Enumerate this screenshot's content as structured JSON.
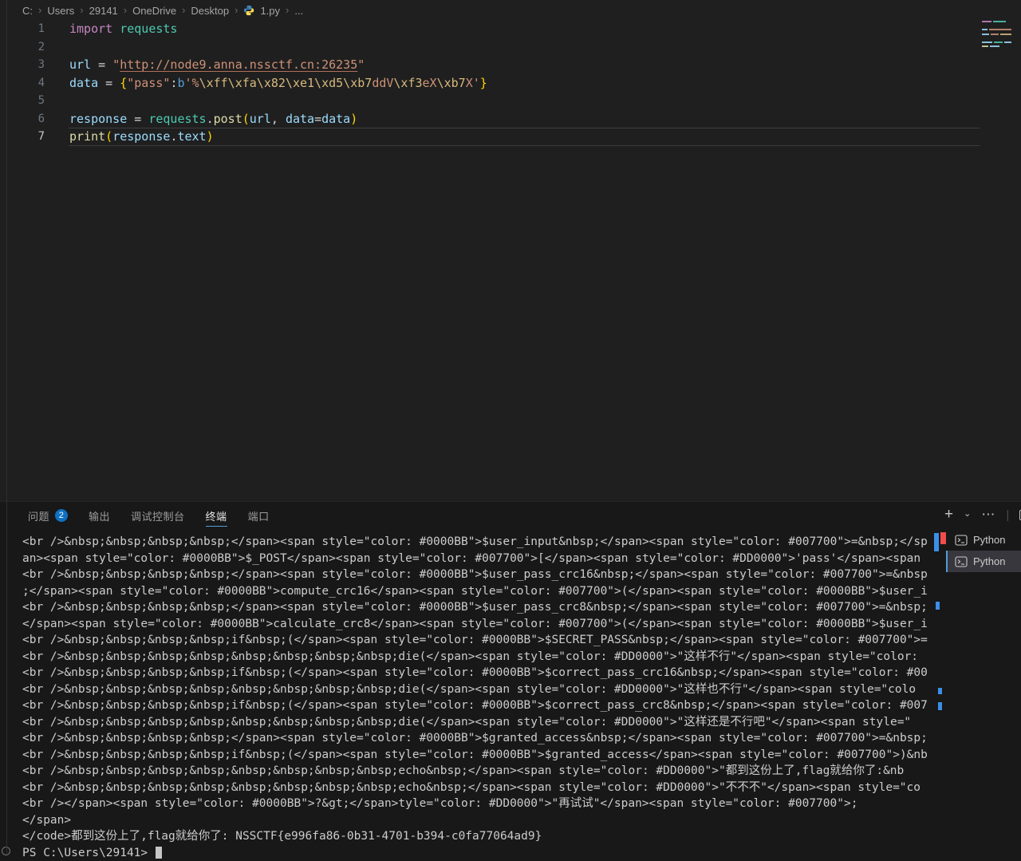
{
  "breadcrumb": {
    "separator": "›",
    "items": [
      "C:",
      "Users",
      "29141",
      "OneDrive",
      "Desktop",
      "1.py",
      "..."
    ]
  },
  "editor": {
    "lines": [
      {
        "num": "1",
        "tokens": [
          [
            "import",
            "kw"
          ],
          [
            " ",
            "op"
          ],
          [
            "requests",
            "type"
          ]
        ]
      },
      {
        "num": "2",
        "tokens": []
      },
      {
        "num": "3",
        "tokens": [
          [
            "url",
            "var"
          ],
          [
            " = ",
            "op"
          ],
          [
            "\"",
            "str"
          ],
          [
            "http://node9.anna.nssctf.cn:26235",
            "strlink"
          ],
          [
            "\"",
            "str"
          ]
        ]
      },
      {
        "num": "4",
        "tokens": [
          [
            "data",
            "var"
          ],
          [
            " = ",
            "op"
          ],
          [
            "{",
            "brace"
          ],
          [
            "\"pass\"",
            "str"
          ],
          [
            ":",
            "op"
          ],
          [
            "b",
            "bpre"
          ],
          [
            "'%",
            "str"
          ],
          [
            "\\xff\\xfa\\x82\\xe1\\xd5\\xb7",
            "esc"
          ],
          [
            "ddV",
            "str"
          ],
          [
            "\\xf3",
            "esc"
          ],
          [
            "eX",
            "str"
          ],
          [
            "\\xb7",
            "esc"
          ],
          [
            "X'",
            "str"
          ],
          [
            "}",
            "brace"
          ]
        ]
      },
      {
        "num": "5",
        "tokens": []
      },
      {
        "num": "6",
        "tokens": [
          [
            "response",
            "var"
          ],
          [
            " = ",
            "op"
          ],
          [
            "requests",
            "type"
          ],
          [
            ".",
            "op"
          ],
          [
            "post",
            "func"
          ],
          [
            "(",
            "brace"
          ],
          [
            "url",
            "var"
          ],
          [
            ", ",
            "op"
          ],
          [
            "data",
            "var"
          ],
          [
            "=",
            "op"
          ],
          [
            "data",
            "var"
          ],
          [
            ")",
            "brace"
          ]
        ]
      },
      {
        "num": "7",
        "current": true,
        "tokens": [
          [
            "print",
            "func"
          ],
          [
            "(",
            "brace"
          ],
          [
            "response",
            "var"
          ],
          [
            ".",
            "op"
          ],
          [
            "text",
            "var"
          ],
          [
            ")",
            "brace"
          ]
        ]
      }
    ]
  },
  "panel": {
    "tabs": [
      {
        "label": "问题",
        "badge": "2"
      },
      {
        "label": "输出"
      },
      {
        "label": "调试控制台"
      },
      {
        "label": "终端",
        "active": true
      },
      {
        "label": "端口"
      }
    ],
    "actions": {
      "new_terminal": "+",
      "launch_profile": "⌄",
      "more": "⋯",
      "separator": "|"
    }
  },
  "terminal": {
    "lines": [
      "<br />&nbsp;&nbsp;&nbsp;&nbsp;</span><span style=\"color: #0000BB\">$user_input&nbsp;</span><span style=\"color: #007700\">=&nbsp;</sp",
      "an><span style=\"color: #0000BB\">$_POST</span><span style=\"color: #007700\">[</span><span style=\"color: #DD0000\">'pass'</span><span ",
      "<br />&nbsp;&nbsp;&nbsp;&nbsp;</span><span style=\"color: #0000BB\">$user_pass_crc16&nbsp;</span><span style=\"color: #007700\">=&nbsp",
      ";</span><span style=\"color: #0000BB\">compute_crc16</span><span style=\"color: #007700\">(</span><span style=\"color: #0000BB\">$user_i",
      "<br />&nbsp;&nbsp;&nbsp;&nbsp;</span><span style=\"color: #0000BB\">$user_pass_crc8&nbsp;</span><span style=\"color: #007700\">=&nbsp;",
      "</span><span style=\"color: #0000BB\">calculate_crc8</span><span style=\"color: #007700\">(</span><span style=\"color: #0000BB\">$user_i",
      "<br />&nbsp;&nbsp;&nbsp;&nbsp;if&nbsp;(</span><span style=\"color: #0000BB\">$SECRET_PASS&nbsp;</span><span style=\"color: #007700\">=",
      "<br />&nbsp;&nbsp;&nbsp;&nbsp;&nbsp;&nbsp;&nbsp;&nbsp;die(</span><span style=\"color: #DD0000\">\"这样不行\"</span><span style=\"color:",
      "<br />&nbsp;&nbsp;&nbsp;&nbsp;if&nbsp;(</span><span style=\"color: #0000BB\">$correct_pass_crc16&nbsp;</span><span style=\"color: #00",
      "<br />&nbsp;&nbsp;&nbsp;&nbsp;&nbsp;&nbsp;&nbsp;&nbsp;die(</span><span style=\"color: #DD0000\">\"这样也不行\"</span><span style=\"colo",
      "<br />&nbsp;&nbsp;&nbsp;&nbsp;if&nbsp;(</span><span style=\"color: #0000BB\">$correct_pass_crc8&nbsp;</span><span style=\"color: #007",
      "<br />&nbsp;&nbsp;&nbsp;&nbsp;&nbsp;&nbsp;&nbsp;&nbsp;die(</span><span style=\"color: #DD0000\">\"这样还是不行吧\"</span><span style=\"",
      "<br />&nbsp;&nbsp;&nbsp;&nbsp;</span><span style=\"color: #0000BB\">$granted_access&nbsp;</span><span style=\"color: #007700\">=&nbsp;",
      "<br />&nbsp;&nbsp;&nbsp;&nbsp;if&nbsp;(</span><span style=\"color: #0000BB\">$granted_access</span><span style=\"color: #007700\">)&nb",
      "<br />&nbsp;&nbsp;&nbsp;&nbsp;&nbsp;&nbsp;&nbsp;&nbsp;echo&nbsp;</span><span style=\"color: #DD0000\">\"都到这份上了,flag就给你了:&nb",
      "<br />&nbsp;&nbsp;&nbsp;&nbsp;&nbsp;&nbsp;&nbsp;&nbsp;echo&nbsp;</span><span style=\"color: #DD0000\">\"不不不\"</span><span style=\"co",
      "<br /></span><span style=\"color: #0000BB\">?&gt;</span>tyle=\"color: #DD0000\">\"再试试\"</span><span style=\"color: #007700\">;",
      "</span>",
      "</code>都到这份上了,flag就给你了: NSSCTF{e996fa86-0b31-4701-b394-c0fa77064ad9}",
      "PS C:\\Users\\29141> "
    ],
    "list": [
      {
        "label": "Python"
      },
      {
        "label": "Python",
        "selected": true
      }
    ]
  },
  "colors": {
    "editor_bg": "#1f1f1f",
    "panel_bg": "#181818",
    "terminal_fg": "#cccccc",
    "badge_blue": "#0e70c0",
    "active_tab_underline": "#4f9cd8",
    "scroll_deco_blue": "#3b8eea",
    "scroll_deco_red": "#f14c4c",
    "html_span_blue": "#0000BB",
    "html_span_green": "#007700",
    "html_span_red": "#DD0000"
  }
}
